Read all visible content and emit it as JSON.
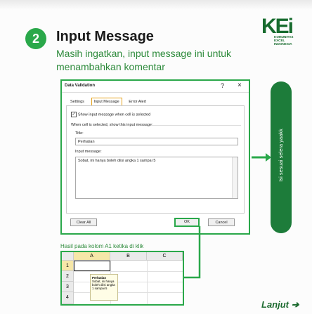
{
  "step": {
    "number": "2",
    "title": "Input Message"
  },
  "subtitle": "Masih ingatkan, input message ini untuk menambahkan komentar",
  "logo": {
    "mark": "KEi",
    "text": "KOMUNITAS\nEXCEL\nINDONESIA"
  },
  "dialog": {
    "title": "Data Validation",
    "help": "?",
    "close": "×",
    "tabs": [
      "Settings",
      "Input Message",
      "Error Alert"
    ],
    "active_tab": 1,
    "checkbox_label": "Show input message when cell is selected",
    "checkbox_checked": true,
    "when_selected_label": "When cell is selected, show this input message:",
    "title_label": "Title:",
    "title_value": "Perhatian",
    "message_label": "Input message:",
    "message_value": "Sobat, ini hanya boleh diisi angka 1 sampai 5",
    "buttons": {
      "clear_all": "Clear All",
      "ok": "OK",
      "cancel": "Cancel"
    }
  },
  "side_note": "Isi sesuai selera yaakk",
  "result_label": "Hasil pada kolom A1 ketika di klik",
  "sheet": {
    "columns": [
      "A",
      "B",
      "C"
    ],
    "rows": [
      "1",
      "2",
      "3",
      "4"
    ],
    "tooltip_title": "Perhatian",
    "tooltip_text": "Sobat, ini hanya boleh diisi angka 1 sampai 5"
  },
  "next_label": "Lanjut",
  "colors": {
    "accent": "#2aa84a",
    "dark_green": "#1d7c3a"
  }
}
